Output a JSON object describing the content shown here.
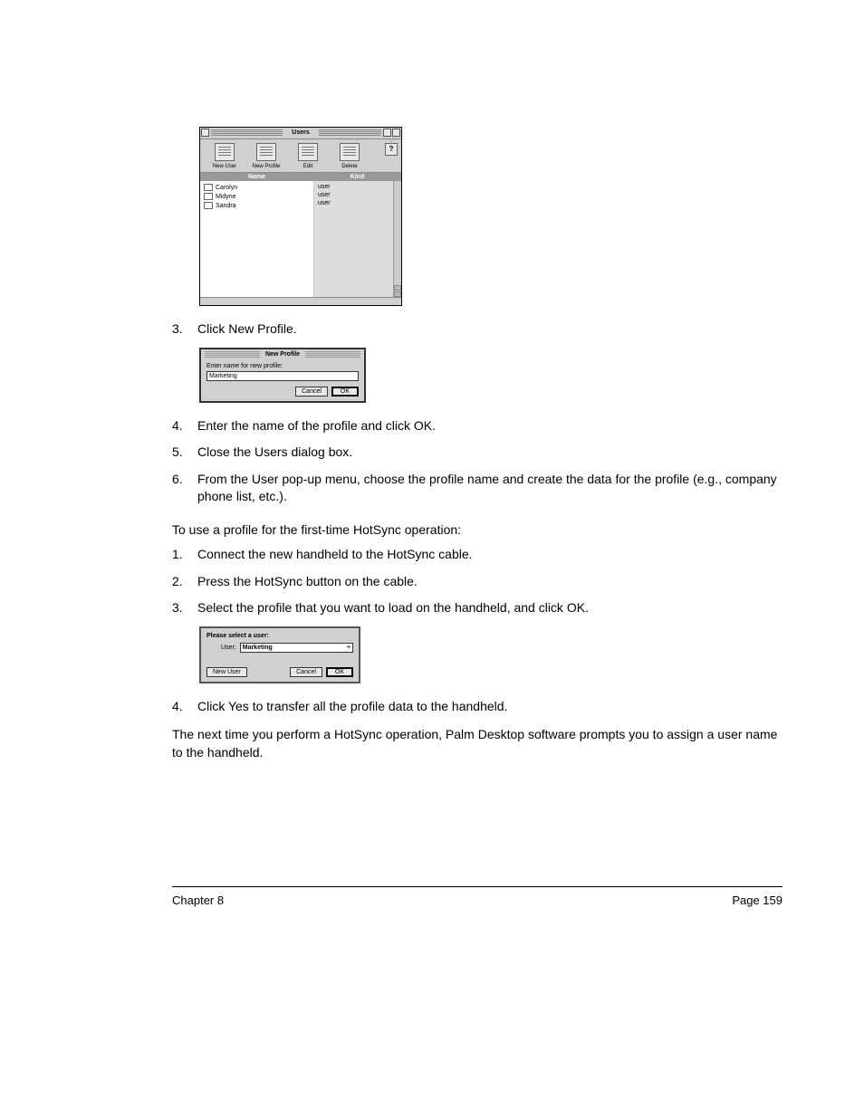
{
  "users_window": {
    "title": "Users",
    "help_label": "?",
    "toolbar": [
      {
        "label": "New User"
      },
      {
        "label": "New Profile"
      },
      {
        "label": "Edit"
      },
      {
        "label": "Delete"
      }
    ],
    "columns": {
      "name": "Name",
      "kind": "Kind"
    },
    "rows": [
      {
        "name": "Carolyn",
        "kind": "user"
      },
      {
        "name": "Midyne",
        "kind": "user"
      },
      {
        "name": "Sandra",
        "kind": "user"
      }
    ]
  },
  "new_profile": {
    "title": "New Profile",
    "prompt": "Enter name for new profile:",
    "value": "Marketing",
    "cancel": "Cancel",
    "ok": "OK"
  },
  "select_user": {
    "prompt": "Please select a user:",
    "field_label": "User:",
    "value": "Marketing",
    "caret": "÷",
    "new_user": "New User",
    "cancel": "Cancel",
    "ok": "OK"
  },
  "steps": {
    "s3_num": "3.",
    "s3_txt": "Click New Profile.",
    "s4_num": "4.",
    "s4_txt": "Enter the name of the profile and click OK.",
    "s5_num": "5.",
    "s5_txt": "Close the Users dialog box.",
    "s6_num": "6.",
    "s6_txt": "From the User pop-up menu, choose the profile name and create the data for the profile (e.g., company phone list, etc.)."
  },
  "section_heading": "To use a profile for the first-time HotSync operation:",
  "hs_steps": {
    "h1_num": "1.",
    "h1_txt": "Connect the new handheld to the HotSync cable.",
    "h2_num": "2.",
    "h2_txt": "Press the HotSync button on the cable.",
    "h3_num": "3.",
    "h3_txt": "Select the profile that you want to load on the handheld, and click OK.",
    "h4_num": "4.",
    "h4_txt": "Click Yes to transfer all the profile data to the handheld."
  },
  "closing_paragraph": "The next time you perform a HotSync operation, Palm Desktop software prompts you to assign a user name to the handheld.",
  "footer": {
    "left": "Chapter 8",
    "right": "Page 159"
  }
}
